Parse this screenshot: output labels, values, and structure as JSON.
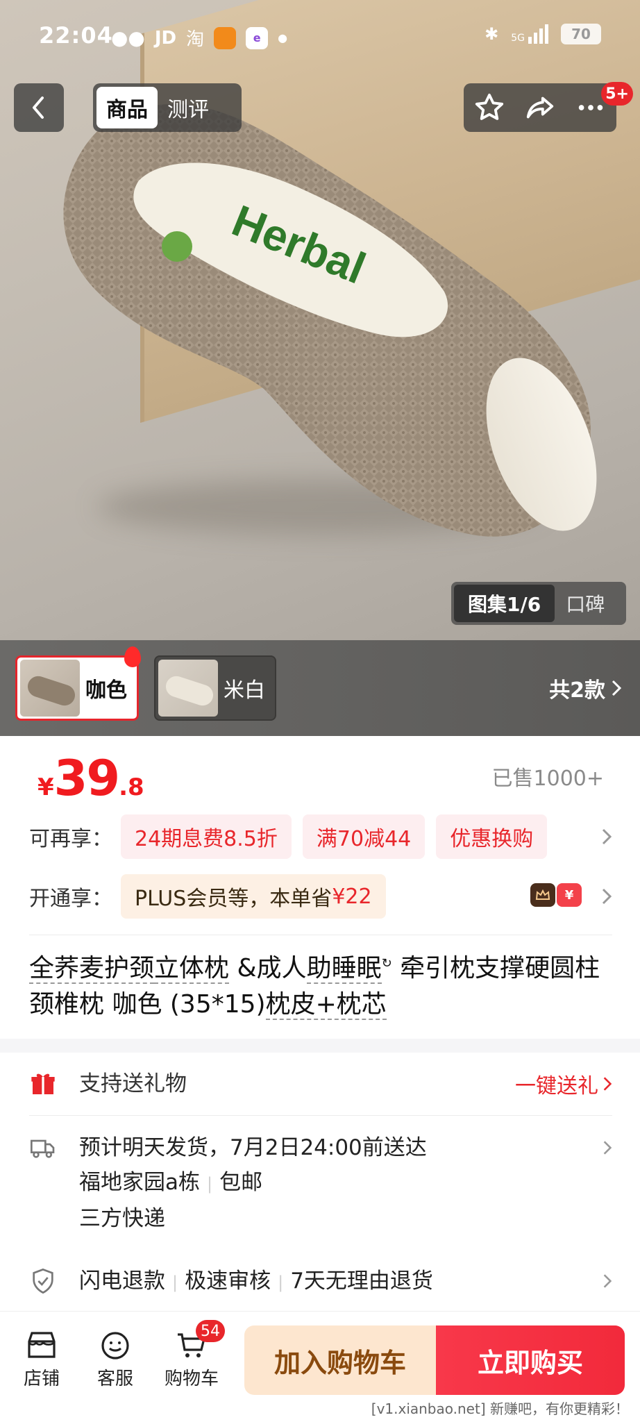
{
  "status_bar": {
    "time": "22:04",
    "apps": [
      "JD",
      "淘"
    ],
    "network": "5G",
    "battery": "70"
  },
  "nav": {
    "tabs": [
      {
        "label": "商品",
        "active": true
      },
      {
        "label": "测评",
        "active": false
      }
    ],
    "badge": "5+"
  },
  "hero": {
    "brand_text": "Herbal",
    "gallery_active": "图集1/6",
    "gallery_other": "口碑"
  },
  "variants": {
    "items": [
      {
        "label": "咖色",
        "selected": true
      },
      {
        "label": "米白",
        "selected": false
      }
    ],
    "total": "共2款"
  },
  "price": {
    "currency": "¥",
    "integer": "39",
    "decimal": ".8",
    "sold": "已售1000+"
  },
  "promos": {
    "label": "可再享：",
    "tags": [
      "24期息费8.5折",
      "满70减44",
      "优惠换购"
    ]
  },
  "plus": {
    "label": "开通享：",
    "text": "PLUS会员等，本单省",
    "amount": "¥22",
    "icon_text": "¥"
  },
  "title": {
    "part1": "全荞麦护颈",
    "part2": "立体枕",
    "part3": " &成人",
    "part4": "助睡眠",
    "part5": " 牵引枕支撑硬圆柱颈椎枕 咖色 (35*15)",
    "part6": "枕皮+枕芯"
  },
  "services": {
    "gift": {
      "text": "支持送礼物",
      "action": "一键送礼"
    },
    "delivery": {
      "line1": "预计明天发货，7月2日24:00前送达",
      "address": "福地家园a栋",
      "shipping": "包邮",
      "carrier": "三方快递"
    },
    "guarantee": [
      "闪电退款",
      "极速审核",
      "7天无理由退货"
    ]
  },
  "bottom_bar": {
    "shop": "店铺",
    "service": "客服",
    "cart": "购物车",
    "cart_count": "54",
    "add_to_cart": "加入购物车",
    "buy_now": "立即购买"
  },
  "watermark": "[v1.xianbao.net] 新赚吧，有你更精彩！",
  "colors": {
    "accent_red": "#e8262b",
    "cart_button_bg": "#fde6cf",
    "buy_button_bg": "#f22a3b"
  }
}
